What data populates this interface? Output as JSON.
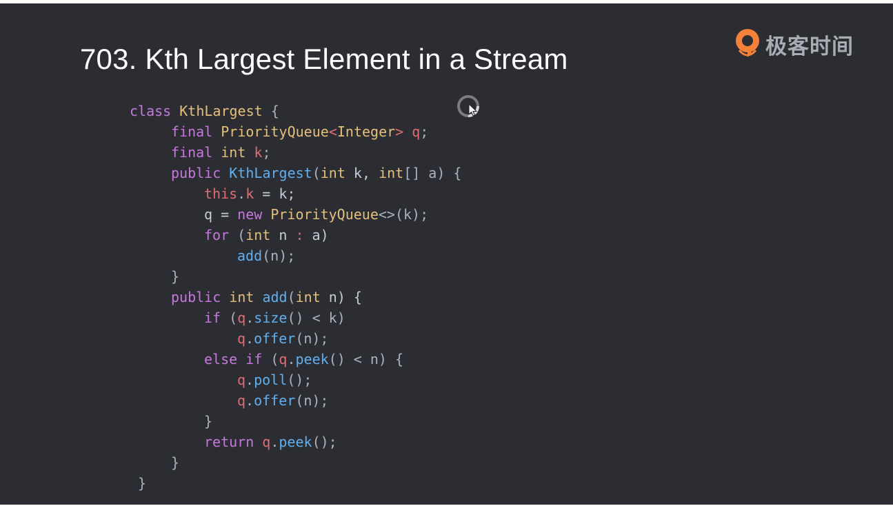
{
  "title": "703. Kth Largest Element in a Stream",
  "logo": {
    "text": "极客时间",
    "icon": "geektime-logo-icon"
  },
  "colors": {
    "background": "#2b2d33",
    "keyword": "#c678dd",
    "type": "#e5c07b",
    "function": "#61afef",
    "field": "#e06c75",
    "identifier": "#c8ccd4",
    "punctuation": "#abb2bf"
  },
  "code": {
    "lines": [
      [
        {
          "t": "class",
          "c": "kw"
        },
        {
          "t": " ",
          "c": "pn"
        },
        {
          "t": "KthLargest",
          "c": "ty"
        },
        {
          "t": " {",
          "c": "pn"
        }
      ],
      [
        {
          "t": "final",
          "c": "kw"
        },
        {
          "t": " ",
          "c": "pn"
        },
        {
          "t": "PriorityQueue",
          "c": "ty"
        },
        {
          "t": "<",
          "c": "var"
        },
        {
          "t": "Integer",
          "c": "ty"
        },
        {
          "t": ">",
          "c": "var"
        },
        {
          "t": " ",
          "c": "pn"
        },
        {
          "t": "q",
          "c": "var"
        },
        {
          "t": ";",
          "c": "pn"
        }
      ],
      [
        {
          "t": "final",
          "c": "kw"
        },
        {
          "t": " ",
          "c": "pn"
        },
        {
          "t": "int",
          "c": "ty"
        },
        {
          "t": " ",
          "c": "pn"
        },
        {
          "t": "k",
          "c": "var"
        },
        {
          "t": ";",
          "c": "pn"
        }
      ],
      [
        {
          "t": "public",
          "c": "kw"
        },
        {
          "t": " ",
          "c": "pn"
        },
        {
          "t": "KthLargest",
          "c": "fn"
        },
        {
          "t": "(",
          "c": "pn"
        },
        {
          "t": "int",
          "c": "ty"
        },
        {
          "t": " k, ",
          "c": "id"
        },
        {
          "t": "int",
          "c": "ty"
        },
        {
          "t": "[] a) {",
          "c": "pn"
        }
      ],
      [
        {
          "t": "this",
          "c": "var"
        },
        {
          "t": ".",
          "c": "pn"
        },
        {
          "t": "k",
          "c": "var"
        },
        {
          "t": " = k;",
          "c": "id"
        }
      ],
      [
        {
          "t": "q = ",
          "c": "id"
        },
        {
          "t": "new",
          "c": "kw"
        },
        {
          "t": " ",
          "c": "pn"
        },
        {
          "t": "PriorityQueue",
          "c": "ty"
        },
        {
          "t": "<>(k);",
          "c": "pn"
        }
      ],
      [
        {
          "t": "for",
          "c": "kw"
        },
        {
          "t": " (",
          "c": "pn"
        },
        {
          "t": "int",
          "c": "ty"
        },
        {
          "t": " n ",
          "c": "id"
        },
        {
          "t": ":",
          "c": "var"
        },
        {
          "t": " a)",
          "c": "id"
        }
      ],
      [
        {
          "t": "add",
          "c": "fn"
        },
        {
          "t": "(n);",
          "c": "pn"
        }
      ],
      [
        {
          "t": "}",
          "c": "pn"
        }
      ],
      [
        {
          "t": "public",
          "c": "kw"
        },
        {
          "t": " ",
          "c": "pn"
        },
        {
          "t": "int",
          "c": "ty"
        },
        {
          "t": " ",
          "c": "pn"
        },
        {
          "t": "add",
          "c": "fn"
        },
        {
          "t": "(",
          "c": "pn"
        },
        {
          "t": "int",
          "c": "ty"
        },
        {
          "t": " n) {",
          "c": "id"
        }
      ],
      [
        {
          "t": "if",
          "c": "kw"
        },
        {
          "t": " (",
          "c": "pn"
        },
        {
          "t": "q",
          "c": "var"
        },
        {
          "t": ".",
          "c": "pn"
        },
        {
          "t": "size",
          "c": "fn"
        },
        {
          "t": "() < k)",
          "c": "pn"
        }
      ],
      [
        {
          "t": "q",
          "c": "var"
        },
        {
          "t": ".",
          "c": "pn"
        },
        {
          "t": "offer",
          "c": "fn"
        },
        {
          "t": "(n);",
          "c": "pn"
        }
      ],
      [
        {
          "t": "else",
          "c": "kw"
        },
        {
          "t": " ",
          "c": "pn"
        },
        {
          "t": "if",
          "c": "kw"
        },
        {
          "t": " (",
          "c": "pn"
        },
        {
          "t": "q",
          "c": "var"
        },
        {
          "t": ".",
          "c": "pn"
        },
        {
          "t": "peek",
          "c": "fn"
        },
        {
          "t": "() < n) {",
          "c": "pn"
        }
      ],
      [
        {
          "t": "q",
          "c": "var"
        },
        {
          "t": ".",
          "c": "pn"
        },
        {
          "t": "poll",
          "c": "fn"
        },
        {
          "t": "();",
          "c": "pn"
        }
      ],
      [
        {
          "t": "q",
          "c": "var"
        },
        {
          "t": ".",
          "c": "pn"
        },
        {
          "t": "offer",
          "c": "fn"
        },
        {
          "t": "(n);",
          "c": "pn"
        }
      ],
      [
        {
          "t": "}",
          "c": "pn"
        }
      ],
      [
        {
          "t": "return",
          "c": "kw"
        },
        {
          "t": " ",
          "c": "pn"
        },
        {
          "t": "q",
          "c": "var"
        },
        {
          "t": ".",
          "c": "pn"
        },
        {
          "t": "peek",
          "c": "fn"
        },
        {
          "t": "();",
          "c": "pn"
        }
      ],
      [
        {
          "t": "}",
          "c": "pn"
        }
      ],
      [
        {
          "t": "}",
          "c": "pn"
        }
      ]
    ]
  },
  "cursor": {
    "icon": "loading-cursor-icon"
  }
}
